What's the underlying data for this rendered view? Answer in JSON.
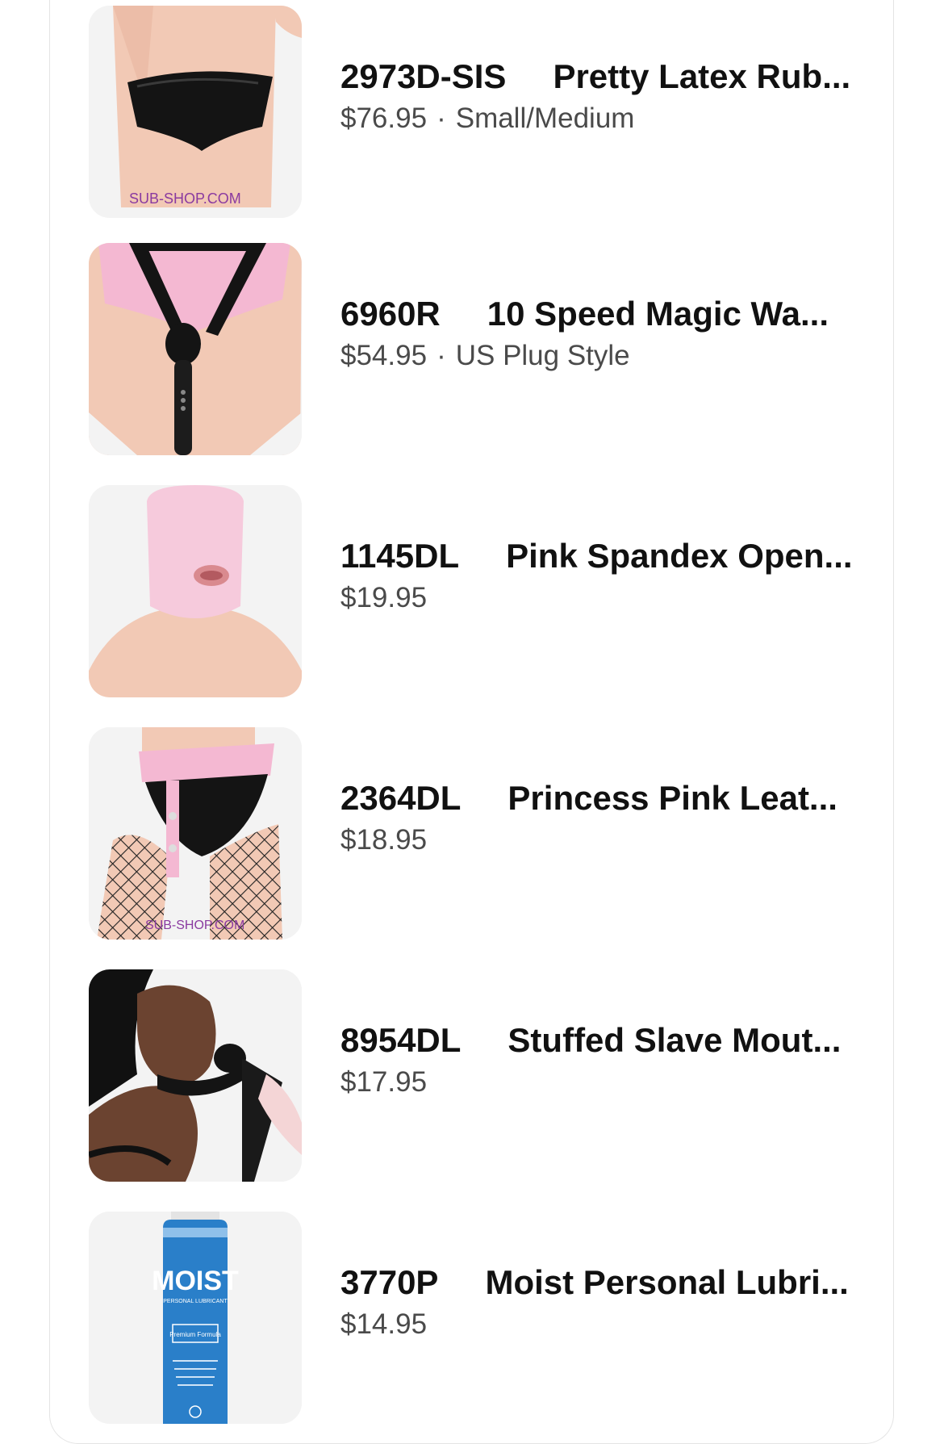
{
  "items": [
    {
      "sku": "2973D-SIS",
      "name": "Pretty Latex Rub...",
      "price": "$76.95",
      "variant": "Small/Medium",
      "image_icon": "latex-briefs-photo",
      "watermark": "SUB-SHOP.COM"
    },
    {
      "sku": "6960R",
      "name": "10 Speed Magic Wa...",
      "price": "$54.95",
      "variant": "US Plug Style",
      "image_icon": "wand-harness-photo",
      "watermark": ""
    },
    {
      "sku": "1145DL",
      "name": "Pink Spandex Open...",
      "price": "$19.95",
      "variant": "",
      "image_icon": "pink-hood-photo",
      "watermark": ""
    },
    {
      "sku": "2364DL",
      "name": "Princess Pink Leat...",
      "price": "$18.95",
      "variant": "",
      "image_icon": "pink-belt-photo",
      "watermark": "SUB-SHOP.COM"
    },
    {
      "sku": "8954DL",
      "name": "Stuffed Slave Mout...",
      "price": "$17.95",
      "variant": "",
      "image_icon": "mouth-gag-photo",
      "watermark": ""
    },
    {
      "sku": "3770P",
      "name": "Moist Personal Lubri...",
      "price": "$14.95",
      "variant": "",
      "image_icon": "lubricant-bottle-photo",
      "watermark": ""
    }
  ],
  "colors": {
    "pink": "#f4b8d2",
    "skin": "#f2c9b5",
    "black": "#141414",
    "blue": "#2a7fc9"
  },
  "bottle_label": {
    "brand": "MOIST",
    "subtitle": "PERSONAL LUBRICANT",
    "badge": "Premium Formula"
  }
}
